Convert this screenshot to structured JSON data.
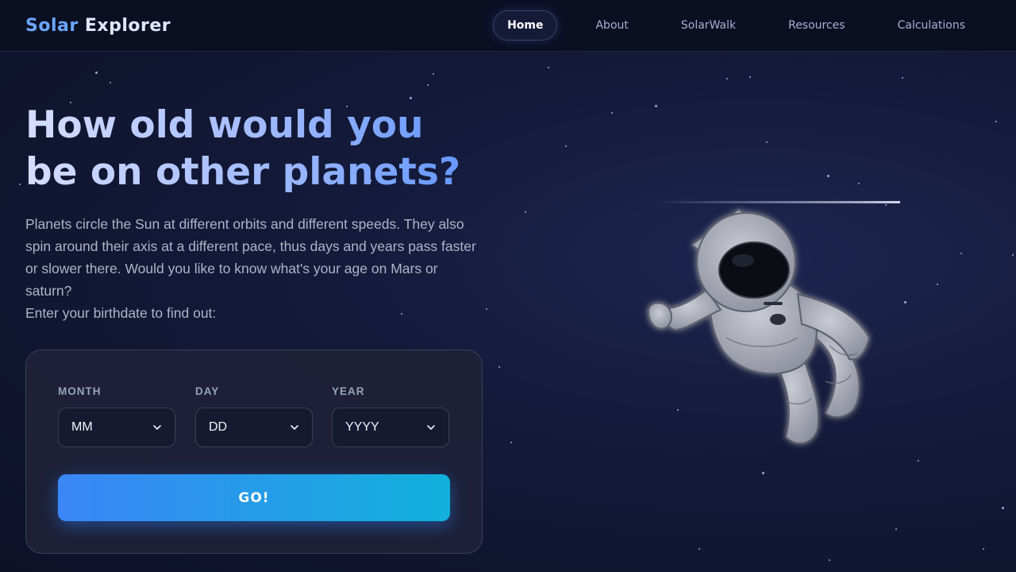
{
  "header": {
    "logo_part1": "Solar",
    "logo_part2": "Explorer",
    "nav": [
      {
        "label": "Home",
        "active": true
      },
      {
        "label": "About",
        "active": false
      },
      {
        "label": "SolarWalk",
        "active": false
      },
      {
        "label": "Resources",
        "active": false
      },
      {
        "label": "Calculations",
        "active": false
      }
    ]
  },
  "hero": {
    "title": "How old would you be on other planets?",
    "description": "Planets circle the Sun at different orbits and different speeds. They also spin around their axis at a different pace, thus days and years pass faster or slower there. Would you like to know what's your age on Mars or saturn?",
    "prompt": "Enter your birthdate to find out:"
  },
  "form": {
    "month": {
      "label": "MONTH",
      "value": "MM"
    },
    "day": {
      "label": "DAY",
      "value": "DD"
    },
    "year": {
      "label": "YEAR",
      "value": "YYYY"
    },
    "submit_label": "GO!"
  },
  "illustration": {
    "icon": "astronaut-illustration"
  },
  "colors": {
    "accent": "#3b86f6",
    "accent2": "#11b1dc",
    "background": "#141a3a",
    "logo_blue": "#6aa6ff"
  }
}
